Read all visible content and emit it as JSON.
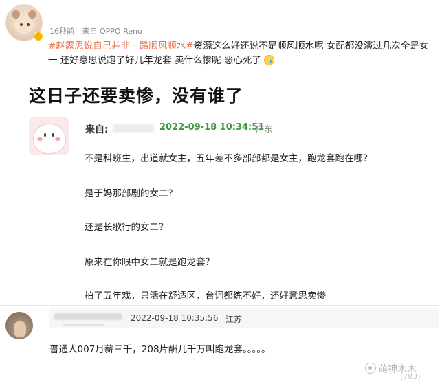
{
  "post": {
    "time": "16秒前",
    "source": "来自 OPPO Reno",
    "topic": "#赵露思说自己并非一路顺风顺水#",
    "text_rest": "资源这么好还说不是顺风顺水呢 女配都没演过几次全是女一 还好意思说跑了好几年龙套 卖什么惨呢 恶心死了",
    "emoji_icon": "crying-face-emoji"
  },
  "caption": "这日子还要卖惨，没有谁了",
  "comment": {
    "from_label": "来自:",
    "date": "2022-09-18 10:34:51",
    "location": "广东",
    "lines": [
      "不是科班生，出道就女主，五年差不多部部都是女主，跑龙套跑在哪？",
      "是于妈那部剧的女二？",
      "还是长歌行的女二？",
      "原来在你眼中女二就是跑龙套？",
      "拍了五年戏，只活在舒适区，台词都练不好，还好意思卖惨"
    ]
  },
  "reply": {
    "date": "2022-09-18 10:35:56",
    "location": "江苏",
    "text": "普通人007月薪三千，208片酬几千万叫跑龙套。。。。。"
  },
  "watermark": {
    "text": "萌神木木",
    "count": "(783)"
  },
  "colors": {
    "topic": "#eb7350",
    "date_green": "#3b9a3b",
    "meta_gray": "#8a8a8a"
  }
}
